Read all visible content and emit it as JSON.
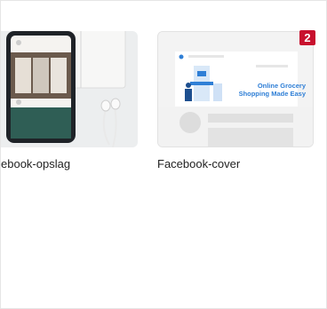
{
  "cards": [
    {
      "label": "ebook-opslag"
    },
    {
      "label": "Facebook-cover",
      "badge": "2",
      "preview": {
        "headline_line1": "Online Grocery",
        "headline_line2": "Shopping Made Easy"
      }
    }
  ],
  "colors": {
    "badge": "#c8102e",
    "preview_blue": "#2f7fd6"
  }
}
